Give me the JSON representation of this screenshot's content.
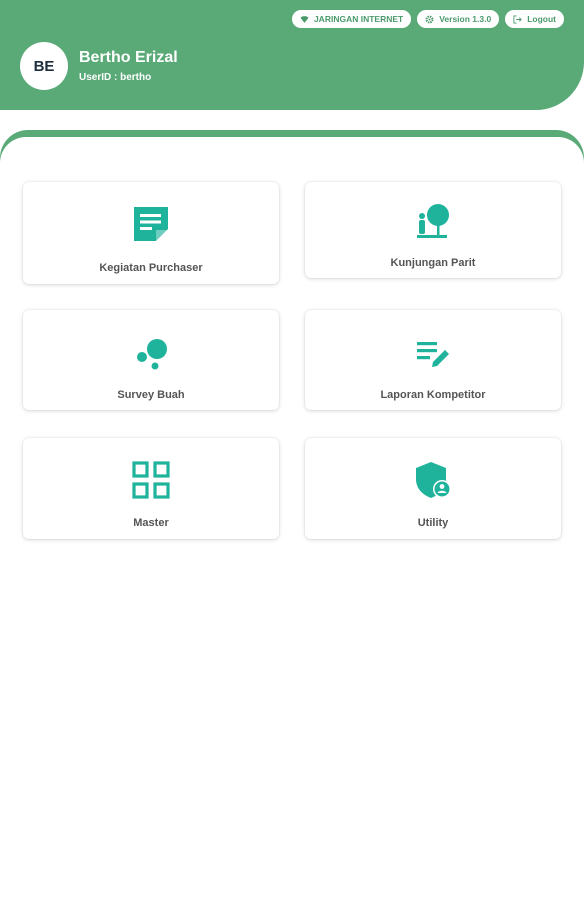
{
  "header": {
    "avatar_initials": "BE",
    "user_name": "Bertho Erizal",
    "user_id": "UserID : bertho",
    "pills": [
      {
        "label": "JARINGAN INTERNET",
        "icon": "wifi-icon"
      },
      {
        "label": "Version 1.3.0",
        "icon": "gear-icon"
      },
      {
        "label": "Logout",
        "icon": "logout-icon"
      }
    ]
  },
  "menu": {
    "items": [
      {
        "label": "Kegiatan Purchaser",
        "icon": "note-icon"
      },
      {
        "label": "Kunjungan Parit",
        "icon": "tree-person-icon"
      },
      {
        "label": "Survey Buah",
        "icon": "bubbles-icon"
      },
      {
        "label": "Laporan Kompetitor",
        "icon": "edit-list-icon"
      },
      {
        "label": "Master",
        "icon": "grid-icon"
      },
      {
        "label": "Utility",
        "icon": "shield-user-icon"
      }
    ]
  },
  "colors": {
    "primary": "#5aaa78",
    "icon": "#1fb39c",
    "pill_text": "#4a9a6c"
  }
}
